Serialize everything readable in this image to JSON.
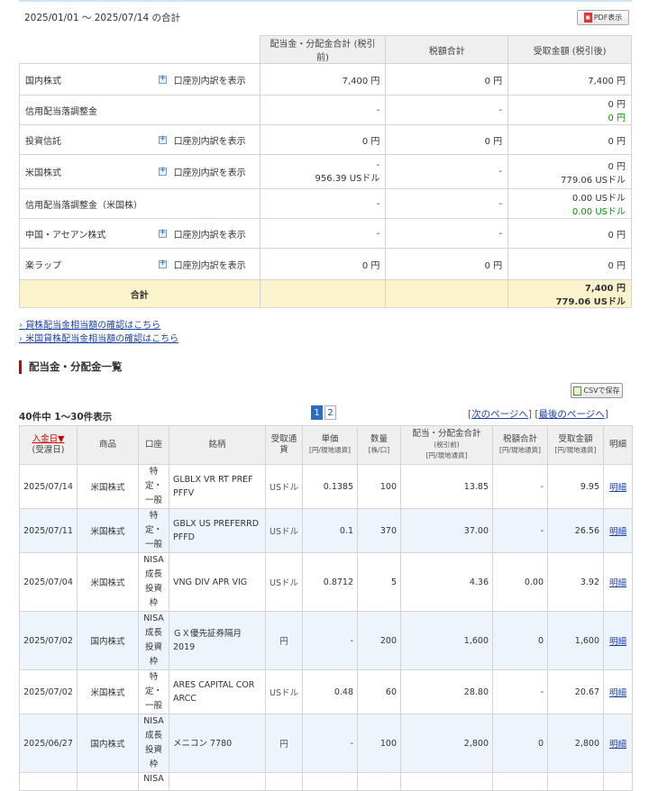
{
  "summary": {
    "period": "2025/01/01 〜 2025/07/14 の合計",
    "pdf_label": "PDF表示",
    "headers": [
      "配当金・分配金合計 (税引前)",
      "税額合計",
      "受取金額 (税引後)"
    ],
    "expand_label": "口座別内訳を表示",
    "rows": [
      {
        "name": "国内株式",
        "pre": "7,400 円",
        "pre2": "",
        "tax": "0 円",
        "post": "7,400 円",
        "post2": ""
      },
      {
        "name": "信用配当落調整金",
        "pre": "-",
        "pre2": "",
        "tax": "-",
        "post": "0 円",
        "post2": "0 円"
      },
      {
        "name": "投資信託",
        "pre": "0 円",
        "pre2": "",
        "tax": "0 円",
        "post": "0 円",
        "post2": ""
      },
      {
        "name": "米国株式",
        "pre": "-",
        "pre2": "956.39 USドル",
        "tax": "-",
        "post": "0 円",
        "post2": "779.06 USドル"
      },
      {
        "name": "信用配当落調整金（米国株）",
        "pre": "-",
        "pre2": "",
        "tax": "-",
        "post": "0.00 USドル",
        "post2": "0.00 USドル"
      },
      {
        "name": "中国・アセアン株式",
        "pre": "-",
        "pre2": "",
        "tax": "-",
        "post": "0 円",
        "post2": ""
      },
      {
        "name": "楽ラップ",
        "pre": "0 円",
        "pre2": "",
        "tax": "0 円",
        "post": "0 円",
        "post2": ""
      }
    ],
    "total_label": "合計",
    "total_post": "7,400 円",
    "total_post2": "779.06 USドル"
  },
  "links": [
    "貸株配当金相当額の確認はこちら",
    "米国貸株配当金相当額の確認はこちら"
  ],
  "list": {
    "title": "配当金・分配金一覧",
    "csv_label": "CSVで保存",
    "count": "40件中 1〜30件表示",
    "pages": [
      "1",
      "2"
    ],
    "next": "次のページへ",
    "last": "最後のページへ",
    "headers": {
      "date": "入金日▼",
      "date_sub": "(受渡日)",
      "product": "商品",
      "account": "口座",
      "name": "銘柄",
      "currency": "受取通貨",
      "unit_price": "単価",
      "unit_price_sub": "[円/現地通貨]",
      "qty": "数量",
      "qty_sub": "[株/口]",
      "total": "配当・分配金合計",
      "total_sub": "(税引前)",
      "total_sub2": "[円/現地通貨]",
      "tax": "税額合計",
      "tax_sub": "[円/現地通貨]",
      "received": "受取金額",
      "received_sub": "[円/現地通貨]",
      "detail": "明細"
    },
    "rows": [
      {
        "date": "2025/07/14",
        "product": "米国株式",
        "account": "特定・一般",
        "name": "GLBLX VR RT PREF PFFV",
        "currency": "USドル",
        "unit_price": "0.1385",
        "qty": "100",
        "total": "13.85",
        "tax": "-",
        "received": "9.95",
        "detail": "明細"
      },
      {
        "date": "2025/07/11",
        "product": "米国株式",
        "account": "特定・一般",
        "name": "GBLX US PREFERRD PFFD",
        "currency": "USドル",
        "unit_price": "0.1",
        "qty": "370",
        "total": "37.00",
        "tax": "-",
        "received": "26.56",
        "detail": "明細"
      },
      {
        "date": "2025/07/04",
        "product": "米国株式",
        "account": "NISA成長投資枠",
        "name": "VNG DIV APR VIG",
        "currency": "USドル",
        "unit_price": "0.8712",
        "qty": "5",
        "total": "4.36",
        "tax": "0.00",
        "received": "3.92",
        "detail": "明細"
      },
      {
        "date": "2025/07/02",
        "product": "国内株式",
        "account": "NISA成長投資枠",
        "name": "ＧＸ優先証券隔月 2019",
        "currency": "円",
        "unit_price": "-",
        "qty": "200",
        "total": "1,600",
        "tax": "0",
        "received": "1,600",
        "detail": "明細"
      },
      {
        "date": "2025/07/02",
        "product": "米国株式",
        "account": "特定・一般",
        "name": "ARES CAPITAL COR ARCC",
        "currency": "USドル",
        "unit_price": "0.48",
        "qty": "60",
        "total": "28.80",
        "tax": "-",
        "received": "20.67",
        "detail": "明細"
      },
      {
        "date": "2025/06/27",
        "product": "国内株式",
        "account": "NISA成長投資枠",
        "name": "メニコン 7780",
        "currency": "円",
        "unit_price": "-",
        "qty": "100",
        "total": "2,800",
        "tax": "0",
        "received": "2,800",
        "detail": "明細"
      },
      {
        "date": "",
        "product": "",
        "account": "NISA",
        "name": "",
        "currency": "",
        "unit_price": "",
        "qty": "",
        "total": "",
        "tax": "",
        "received": "",
        "detail": ""
      }
    ]
  }
}
